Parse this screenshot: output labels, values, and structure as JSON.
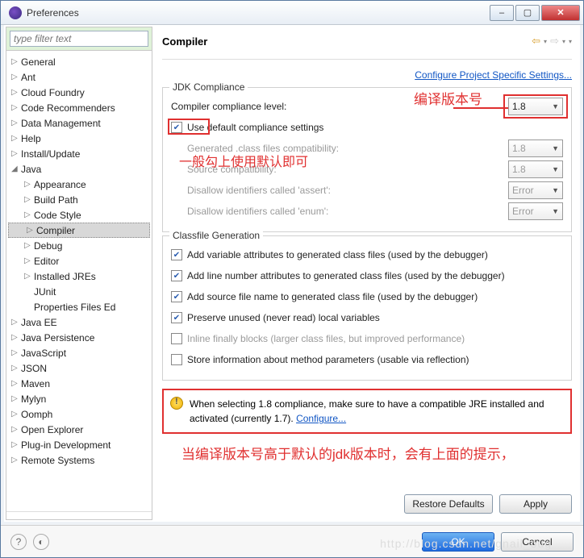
{
  "window": {
    "title": "Preferences"
  },
  "sidebar": {
    "filter_placeholder": "type filter text",
    "items": [
      {
        "label": "General",
        "level": 0,
        "exp": "▷"
      },
      {
        "label": "Ant",
        "level": 0,
        "exp": "▷"
      },
      {
        "label": "Cloud Foundry",
        "level": 0,
        "exp": "▷"
      },
      {
        "label": "Code Recommenders",
        "level": 0,
        "exp": "▷"
      },
      {
        "label": "Data Management",
        "level": 0,
        "exp": "▷"
      },
      {
        "label": "Help",
        "level": 0,
        "exp": "▷"
      },
      {
        "label": "Install/Update",
        "level": 0,
        "exp": "▷"
      },
      {
        "label": "Java",
        "level": 0,
        "exp": "◢"
      },
      {
        "label": "Appearance",
        "level": 1,
        "exp": "▷"
      },
      {
        "label": "Build Path",
        "level": 1,
        "exp": "▷"
      },
      {
        "label": "Code Style",
        "level": 1,
        "exp": "▷"
      },
      {
        "label": "Compiler",
        "level": 1,
        "exp": "▷",
        "selected": true
      },
      {
        "label": "Debug",
        "level": 1,
        "exp": "▷"
      },
      {
        "label": "Editor",
        "level": 1,
        "exp": "▷"
      },
      {
        "label": "Installed JREs",
        "level": 1,
        "exp": "▷"
      },
      {
        "label": "JUnit",
        "level": 1,
        "exp": ""
      },
      {
        "label": "Properties Files Ed",
        "level": 1,
        "exp": ""
      },
      {
        "label": "Java EE",
        "level": 0,
        "exp": "▷"
      },
      {
        "label": "Java Persistence",
        "level": 0,
        "exp": "▷"
      },
      {
        "label": "JavaScript",
        "level": 0,
        "exp": "▷"
      },
      {
        "label": "JSON",
        "level": 0,
        "exp": "▷"
      },
      {
        "label": "Maven",
        "level": 0,
        "exp": "▷"
      },
      {
        "label": "Mylyn",
        "level": 0,
        "exp": "▷"
      },
      {
        "label": "Oomph",
        "level": 0,
        "exp": "▷"
      },
      {
        "label": "Open Explorer",
        "level": 0,
        "exp": "▷"
      },
      {
        "label": "Plug-in Development",
        "level": 0,
        "exp": "▷"
      },
      {
        "label": "Remote Systems",
        "level": 0,
        "exp": "▷"
      }
    ]
  },
  "main": {
    "title": "Compiler",
    "project_link": "Configure Project Specific Settings...",
    "jdk": {
      "group_title": "JDK Compliance",
      "compliance_label": "Compiler compliance level:",
      "compliance_value": "1.8",
      "use_default_label": "Use default compliance settings",
      "use_default_checked": true,
      "gen_class_label": "Generated .class files compatibility:",
      "gen_class_value": "1.8",
      "src_compat_label": "Source compatibility:",
      "src_compat_value": "1.8",
      "assert_label": "Disallow identifiers called 'assert':",
      "assert_value": "Error",
      "enum_label": "Disallow identifiers called 'enum':",
      "enum_value": "Error"
    },
    "classfile": {
      "group_title": "Classfile Generation",
      "opts": [
        {
          "label": "Add variable attributes to generated class files (used by the debugger)",
          "checked": true,
          "enabled": true
        },
        {
          "label": "Add line number attributes to generated class files (used by the debugger)",
          "checked": true,
          "enabled": true
        },
        {
          "label": "Add source file name to generated class file (used by the debugger)",
          "checked": true,
          "enabled": true
        },
        {
          "label": "Preserve unused (never read) local variables",
          "checked": true,
          "enabled": true
        },
        {
          "label": "Inline finally blocks (larger class files, but improved performance)",
          "checked": false,
          "enabled": false
        },
        {
          "label": "Store information about method parameters (usable via reflection)",
          "checked": false,
          "enabled": true
        }
      ]
    },
    "warning": {
      "text": "When selecting 1.8 compliance, make sure to have a compatible JRE installed and activated (currently 1.7). ",
      "link": "Configure..."
    },
    "buttons": {
      "restore": "Restore Defaults",
      "apply": "Apply",
      "ok": "OK",
      "cancel": "Cancel"
    }
  },
  "annotations": {
    "a1": "编译版本号",
    "a2": "一般勾上使用默认即可",
    "a3": "当编译版本号高于默认的jdk版本时，会有上面的提示，"
  },
  "watermark": "http://blog.csdn.net/gnail_oug"
}
